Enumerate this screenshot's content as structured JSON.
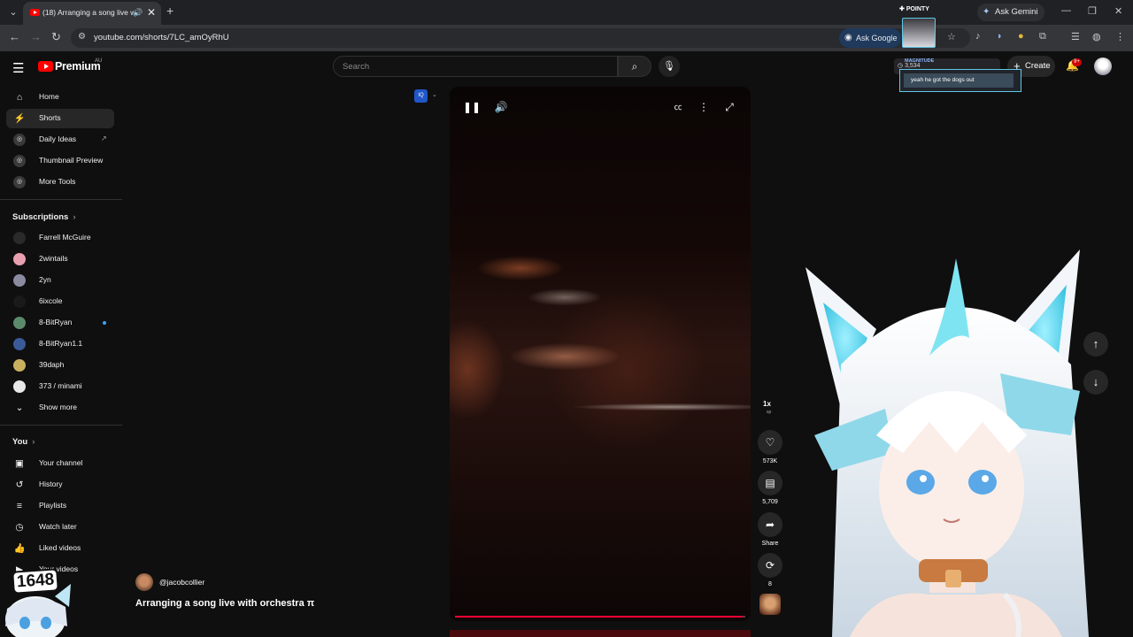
{
  "browser": {
    "tab_title": "(18) Arranging a song live w",
    "url": "youtube.com/shorts/7LC_amOyRhU",
    "ask_gemini": "Ask Gemini",
    "ask_google": "Ask Google",
    "ext_label": "POINTY"
  },
  "header": {
    "logo": "Premium",
    "country": "AU",
    "search_placeholder": "Search",
    "create": "Create",
    "notifications": "9+",
    "magnitude_label": "MAGNITUDE",
    "magnitude_value": "3,534"
  },
  "sidebar": {
    "main": [
      {
        "label": "Home",
        "icon": "home-icon"
      },
      {
        "label": "Shorts",
        "icon": "shorts-icon"
      },
      {
        "label": "Daily Ideas",
        "icon": "extension-icon"
      },
      {
        "label": "Thumbnail Preview",
        "icon": "extension-icon"
      },
      {
        "label": "More Tools",
        "icon": "extension-icon"
      }
    ],
    "subscriptions_title": "Subscriptions",
    "subscriptions": [
      {
        "label": "Farrell McGuire",
        "color": "#2a2a2a"
      },
      {
        "label": "2wintails",
        "color": "#e8a0b0"
      },
      {
        "label": "2yn",
        "color": "#8a8aa0"
      },
      {
        "label": "6ixcole",
        "color": "#1a1a1a"
      },
      {
        "label": "8-BitRyan",
        "color": "#5a8a6a"
      },
      {
        "label": "8-BitRyan1.1",
        "color": "#3a5a9a"
      },
      {
        "label": "39daph",
        "color": "#c8b060"
      },
      {
        "label": "373 / minami",
        "color": "#e8e8e8"
      }
    ],
    "show_more": "Show more",
    "you_title": "You",
    "you": [
      {
        "label": "Your channel",
        "icon": "channel-icon"
      },
      {
        "label": "History",
        "icon": "history-icon"
      },
      {
        "label": "Playlists",
        "icon": "playlists-icon"
      },
      {
        "label": "Watch later",
        "icon": "watch-later-icon"
      },
      {
        "label": "Liked videos",
        "icon": "like-icon"
      },
      {
        "label": "Your videos",
        "icon": "videos-icon"
      }
    ]
  },
  "short": {
    "channel": "@jacobcollier",
    "title": "Arranging a song live with orchestra π",
    "playback_speed": "1x",
    "likes": "573K",
    "comments": "5,709",
    "share": "Share",
    "remix_count": "8",
    "progress_fraction": 0.99
  },
  "overlay": {
    "chat_message": "yeah he got the dogs out",
    "counter": "1648"
  },
  "colors": {
    "accent": "#ff0000",
    "progress": "#ff0033",
    "overlay_border": "#5ec8e5"
  }
}
